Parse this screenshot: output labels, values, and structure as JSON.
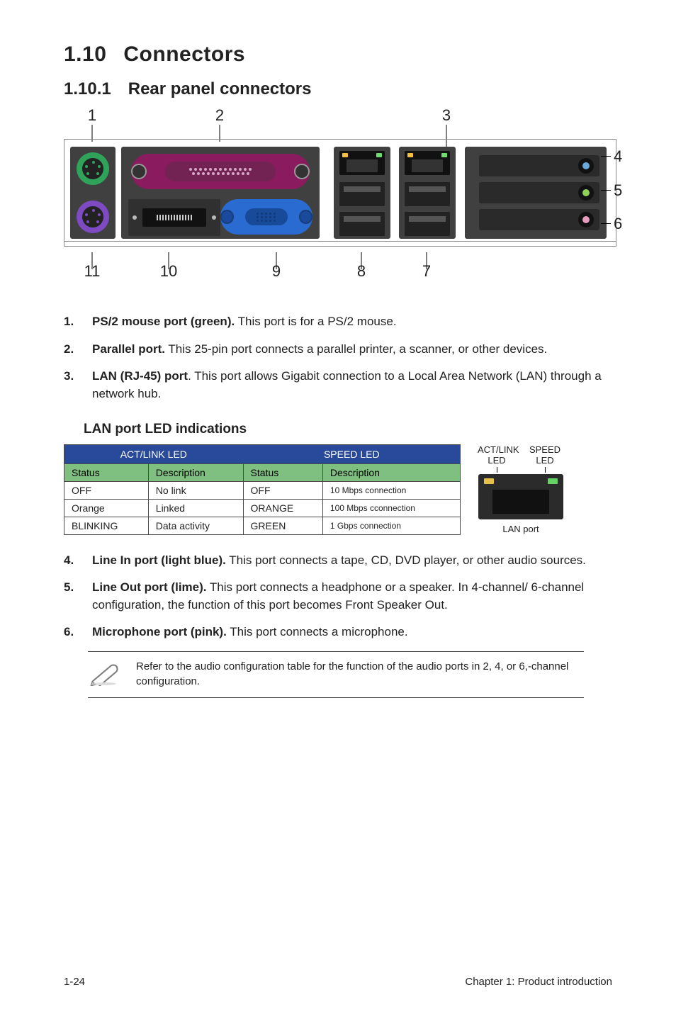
{
  "heading": {
    "num": "1.10",
    "title": "Connectors"
  },
  "subheading": {
    "num": "1.10.1",
    "title": "Rear panel connectors"
  },
  "panel_labels": {
    "top": {
      "l1": "1",
      "l2": "2",
      "l3": "3"
    },
    "right": {
      "r4": "4",
      "r5": "5",
      "r6": "6"
    },
    "bottom": {
      "b7": "7",
      "b8": "8",
      "b9": "9",
      "b10": "10",
      "b11": "11"
    }
  },
  "items_a": [
    {
      "n": "1.",
      "bold": "PS/2 mouse port (green).",
      "rest": " This port is for a PS/2 mouse."
    },
    {
      "n": "2.",
      "bold": "Parallel port.",
      "rest": " This 25-pin port connects a parallel printer, a scanner, or other devices."
    },
    {
      "n": "3.",
      "bold": "LAN (RJ-45) port",
      "rest": ". This port allows Gigabit connection to a Local Area Network (LAN) through a network hub."
    }
  ],
  "lan_heading": "LAN port LED indications",
  "led_table": {
    "group_a": "ACT/LINK LED",
    "group_b": "SPEED LED",
    "sub_status": "Status",
    "sub_desc": "Description",
    "rows": [
      {
        "a_status": "OFF",
        "a_desc": "No link",
        "b_status": "OFF",
        "b_desc": "10 Mbps connection"
      },
      {
        "a_status": "Orange",
        "a_desc": "Linked",
        "b_status": "ORANGE",
        "b_desc": "100 Mbps cconnection"
      },
      {
        "a_status": "BLINKING",
        "a_desc": "Data activity",
        "b_status": "GREEN",
        "b_desc": "1 Gbps connection"
      }
    ]
  },
  "lan_side": {
    "act": "ACT/LINK LED",
    "speed": "SPEED LED",
    "caption": "LAN port"
  },
  "items_b": [
    {
      "n": "4.",
      "bold": "Line In port (light blue).",
      "rest": " This port connects a tape, CD, DVD player, or other audio sources."
    },
    {
      "n": "5.",
      "bold": "Line Out port (lime).",
      "rest": " This port connects a headphone or a speaker. In 4-channel/ 6-channel configuration, the function of this port becomes Front Speaker Out."
    },
    {
      "n": "6.",
      "bold": "Microphone port (pink).",
      "rest": " This port connects a microphone."
    }
  ],
  "note": "Refer to the audio configuration table for the function of the audio ports in 2, 4, or 6,-channel configuration.",
  "footer": {
    "left": "1-24",
    "right": "Chapter 1: Product introduction"
  }
}
